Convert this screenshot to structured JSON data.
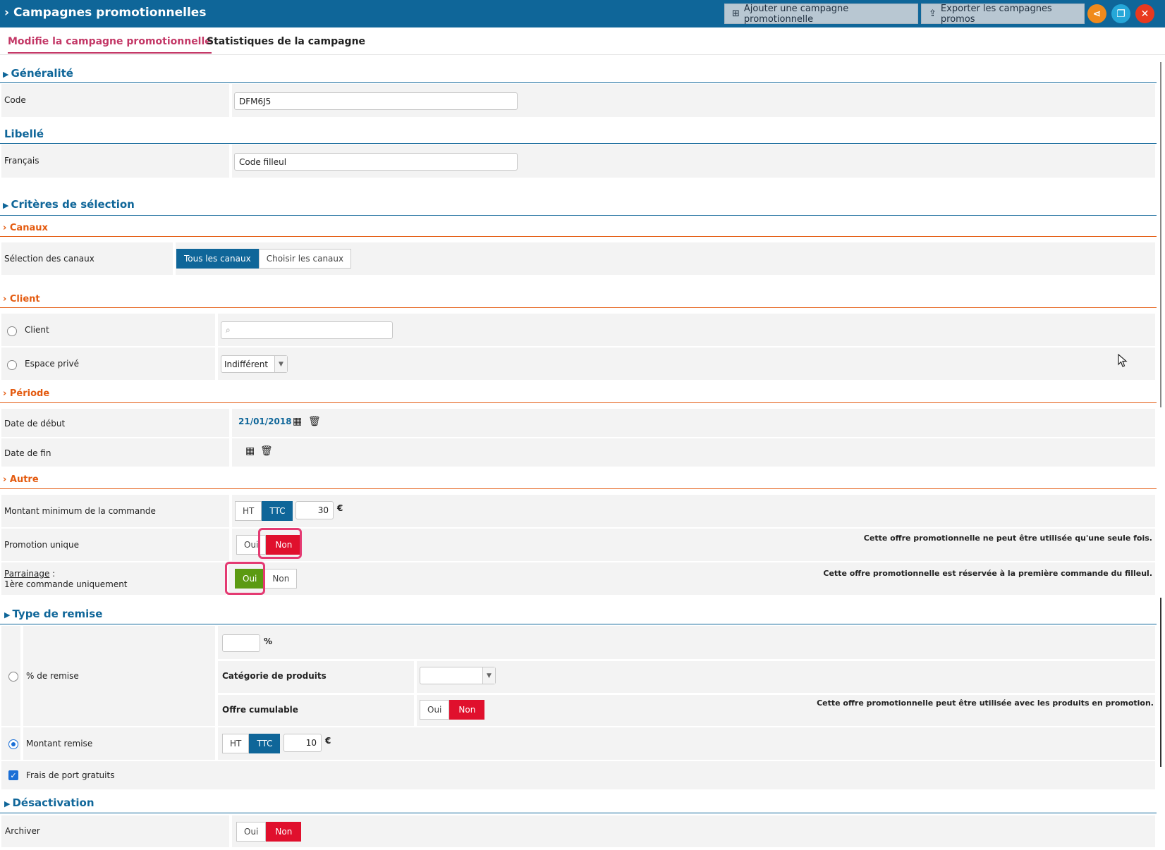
{
  "header": {
    "title": "Campagnes promotionnelles",
    "add_label": "Ajouter une campagne promotionnelle",
    "export_label": "Exporter les campagnes promos"
  },
  "tabs": [
    {
      "label": "Modifie la campagne promotionnelle"
    },
    {
      "label": "Statistiques de la campagne"
    }
  ],
  "generalite": {
    "title": "Généralité",
    "code_label": "Code",
    "code_value": "DFM6J5"
  },
  "libelle": {
    "title": "Libellé",
    "fr_label": "Français",
    "fr_value": "Code filleul"
  },
  "criteres": {
    "title": "Critères de sélection",
    "canaux": {
      "title": "Canaux",
      "label": "Sélection des canaux",
      "opt_all": "Tous les canaux",
      "opt_choose": "Choisir les canaux"
    },
    "client": {
      "title": "Client",
      "client_label": "Client",
      "espace_label": "Espace privé",
      "espace_value": "Indifférent"
    },
    "periode": {
      "title": "Période",
      "start_label": "Date de début",
      "start_value": "21/01/2018",
      "end_label": "Date de fin"
    },
    "autre": {
      "title": "Autre",
      "min_label": "Montant minimum de la commande",
      "ht": "HT",
      "ttc": "TTC",
      "min_value": "30",
      "currency": "€",
      "unique_label": "Promotion unique",
      "oui": "Oui",
      "non": "Non",
      "unique_note": "Cette offre promotionnelle ne peut être utilisée qu'une seule fois.",
      "parrainage_label": "Parrainage",
      "parrainage_sep": " :",
      "parrainage_sub": "1ère commande uniquement",
      "parrainage_note": "Cette offre promotionnelle est réservée à la première commande du filleul."
    }
  },
  "remise": {
    "title": "Type de remise",
    "pct_label": "% de remise",
    "pct_unit": "%",
    "cat_label": "Catégorie de produits",
    "cumul_label": "Offre cumulable",
    "cumul_note": "Cette offre promotionnelle peut être utilisée avec les produits en promotion.",
    "montant_label": "Montant remise",
    "montant_value": "10",
    "port_label": "Frais de port gratuits"
  },
  "desactivation": {
    "title": "Désactivation",
    "archiver_label": "Archiver"
  },
  "colors": {
    "brand": "#0f6699",
    "accent_orange": "#e45b10",
    "no_red": "#e0102d",
    "yes_green": "#5b9a12",
    "highlight": "#e43a72"
  }
}
